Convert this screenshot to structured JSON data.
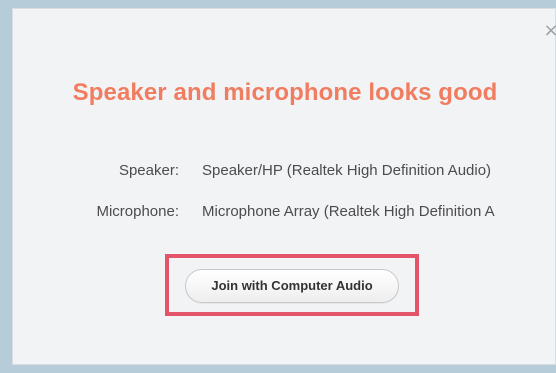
{
  "dialog": {
    "close_glyph": "×",
    "title": "Speaker and microphone looks good",
    "speaker": {
      "label": "Speaker:",
      "value": "Speaker/HP (Realtek High Definition Audio)"
    },
    "microphone": {
      "label": "Microphone:",
      "value": "Microphone Array (Realtek High Definition A"
    },
    "join_button_label": "Join with Computer Audio"
  },
  "colors": {
    "title": "#f07d60",
    "highlight_border": "#e2556b",
    "dialog_background": "#f2f3f5",
    "outer_background": "#b7ccd9"
  }
}
